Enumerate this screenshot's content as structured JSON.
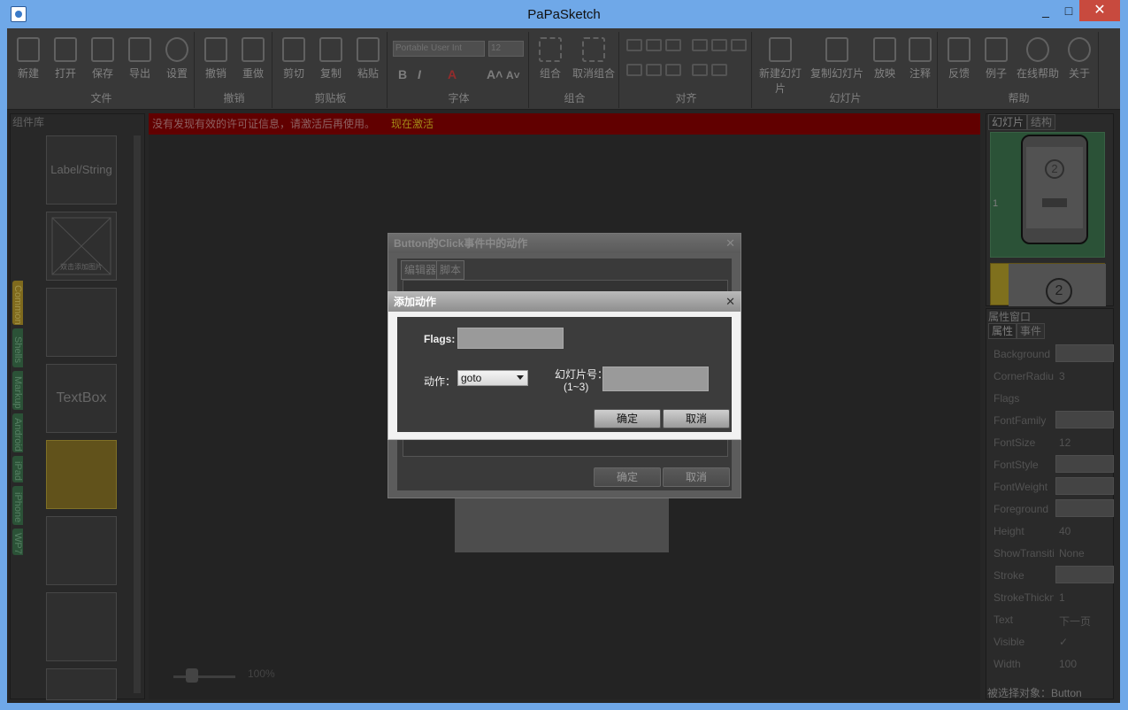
{
  "window": {
    "title": "PaPaSketch",
    "minimize": "_",
    "maximize": "□",
    "close": "✕"
  },
  "ribbon": {
    "groups": [
      {
        "label": "文件",
        "buttons": [
          "新建",
          "打开",
          "保存",
          "导出",
          "设置"
        ]
      },
      {
        "label": "撤销",
        "buttons": [
          "撤销",
          "重做"
        ]
      },
      {
        "label": "剪贴板",
        "buttons": [
          "剪切",
          "复制",
          "粘贴"
        ]
      },
      {
        "label": "字体",
        "font_name": "Portable User Int",
        "font_size": "12",
        "tools": [
          "B",
          "I",
          "A",
          "A˄",
          "A˅"
        ]
      },
      {
        "label": "组合",
        "buttons": [
          "组合",
          "取消组合"
        ]
      },
      {
        "label": "对齐",
        "buttons": []
      },
      {
        "label": "幻灯片",
        "buttons": [
          "新建幻灯片",
          "复制幻灯片",
          "放映",
          "注释"
        ]
      },
      {
        "label": "帮助",
        "buttons": [
          "反馈",
          "例子",
          "在线帮助",
          "关于"
        ]
      }
    ]
  },
  "library": {
    "title": "组件库",
    "items": [
      "Label/String",
      "双击添加图片",
      "",
      "TextBox",
      "",
      "",
      ""
    ],
    "tabs": [
      "Common",
      "Shells",
      "Markup",
      "Android",
      "iPad",
      "iPhone",
      "WP7"
    ]
  },
  "canvas": {
    "license_msg": "没有发现有效的许可证信息，请激活后再使用。",
    "activate_link": "现在激活",
    "zoom": "100%"
  },
  "slides": {
    "tabs": [
      "幻灯片",
      "结构"
    ],
    "first_num": "1",
    "first_label": "2",
    "second_label": "2"
  },
  "properties": {
    "title": "属性窗口",
    "tabs": [
      "属性",
      "事件"
    ],
    "rows": [
      {
        "name": "Background",
        "value": "",
        "type": "combo"
      },
      {
        "name": "CornerRadius",
        "value": "3",
        "type": "text"
      },
      {
        "name": "Flags",
        "value": "",
        "type": "text"
      },
      {
        "name": "FontFamily",
        "value": "",
        "type": "combo"
      },
      {
        "name": "FontSize",
        "value": "12",
        "type": "text"
      },
      {
        "name": "FontStyle",
        "value": "",
        "type": "combo"
      },
      {
        "name": "FontWeight",
        "value": "",
        "type": "combo"
      },
      {
        "name": "Foreground",
        "value": "",
        "type": "combo"
      },
      {
        "name": "Height",
        "value": "40",
        "type": "text"
      },
      {
        "name": "ShowTransition",
        "value": "None",
        "type": "text"
      },
      {
        "name": "Stroke",
        "value": "",
        "type": "combo"
      },
      {
        "name": "StrokeThickness",
        "value": "1",
        "type": "text"
      },
      {
        "name": "Text",
        "value": "下一页",
        "type": "text"
      },
      {
        "name": "Visible",
        "value": "✓",
        "type": "text"
      },
      {
        "name": "Width",
        "value": "100",
        "type": "text"
      }
    ],
    "status": "被选择对象：Button"
  },
  "back_dialog": {
    "title": "Button的Click事件中的动作",
    "close": "✕",
    "tabs": [
      "编辑器",
      "脚本"
    ],
    "ok": "确定",
    "cancel": "取消"
  },
  "add_action_dialog": {
    "title": "添加动作",
    "close": "✕",
    "flags_label": "Flags:",
    "flags_value": "",
    "action_label": "动作：",
    "action_value": "goto",
    "slide_label": "幻灯片号：",
    "slide_range": "(1~3)",
    "slide_value": "",
    "ok": "确定",
    "cancel": "取消"
  }
}
